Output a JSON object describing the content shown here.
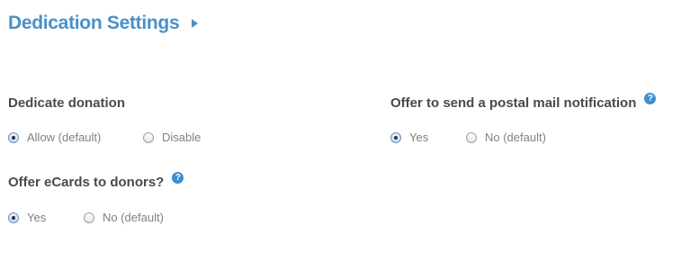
{
  "header": {
    "title": "Dedication Settings"
  },
  "dedicate": {
    "label": "Dedicate donation",
    "options": [
      {
        "label": "Allow (default)",
        "checked": true
      },
      {
        "label": "Disable",
        "checked": false
      }
    ]
  },
  "postal": {
    "label": "Offer to send a postal mail notification",
    "help": "?",
    "options": [
      {
        "label": "Yes",
        "checked": true
      },
      {
        "label": "No (default)",
        "checked": false
      }
    ]
  },
  "ecards": {
    "label": "Offer eCards to donors?",
    "help": "?",
    "options": [
      {
        "label": "Yes",
        "checked": true
      },
      {
        "label": "No (default)",
        "checked": false
      }
    ]
  },
  "colors": {
    "title": "#4a90c8",
    "help_icon": "#3d8fd1",
    "label_text": "#4a4a4a",
    "option_text": "#808080"
  }
}
